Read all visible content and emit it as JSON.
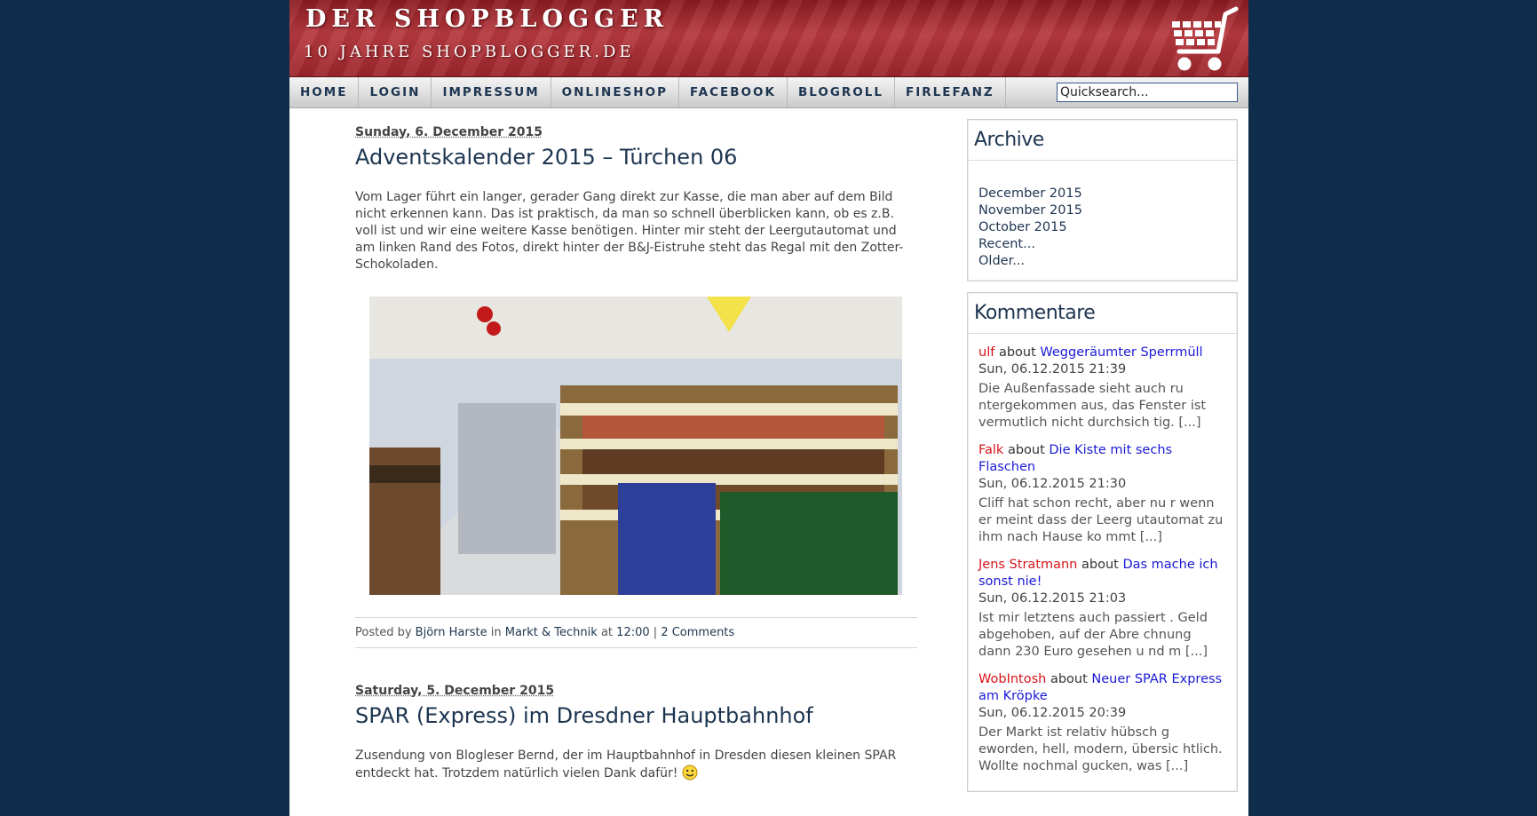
{
  "header": {
    "title": "DER SHOPBLOGGER",
    "subtitle": "10 JAHRE SHOPBLOGGER.DE"
  },
  "nav": {
    "items": [
      "HOME",
      "LOGIN",
      "IMPRESSUM",
      "ONLINESHOP",
      "FACEBOOK",
      "BLOGROLL",
      "FIRLEFANZ"
    ],
    "search_placeholder": "Quicksearch..."
  },
  "posts": [
    {
      "date": "Sunday, 6. December 2015",
      "title": "Adventskalender 2015 – Türchen 06",
      "body": "Vom Lager führt ein langer, gerader Gang direkt zur Kasse, die man aber auf dem Bild nicht erkennen kann. Das ist praktisch, da man so schnell überblicken kann, ob es z.B. voll ist und wir eine weitere Kasse benötigen. Hinter mir steht der Leergutautomat und am linken Rand des Fotos, direkt hinter der B&J-Eistruhe steht das Regal mit den Zotter-Schokoladen.",
      "footer": {
        "posted_by_label": "Posted by",
        "author": "Björn Harste",
        "in_label": "in",
        "category": "Markt & Technik",
        "at_label": "at",
        "time": "12:00",
        "separator": "|",
        "comments": "2 Comments"
      }
    },
    {
      "date": "Saturday, 5. December 2015",
      "title": "SPAR (Express) im Dresdner Hauptbahnhof",
      "body": "Zusendung von Blogleser Bernd, der im Hauptbahnhof in Dresden diesen kleinen SPAR entdeckt hat. Trotzdem natürlich vielen Dank dafür!"
    }
  ],
  "sidebar": {
    "archive": {
      "title": "Archive",
      "items": [
        "December 2015",
        "November 2015",
        "October 2015",
        "Recent...",
        "Older..."
      ]
    },
    "comments": {
      "title": "Kommentare",
      "about_label": "about",
      "items": [
        {
          "author": "ulf",
          "post": "Weggeräumter Sperrmüll",
          "time": "Sun, 06.12.2015 21:39",
          "text": "Die Außenfassade sieht auch ru ntergekommen aus, das Fenster ist vermutlich nicht durchsich tig. [...]"
        },
        {
          "author": "Falk",
          "post": "Die Kiste mit sechs Flaschen",
          "time": "Sun, 06.12.2015 21:30",
          "text": "Cliff hat schon recht, aber nu r wenn er meint dass der Leerg utautomat zu ihm nach Hause ko mmt [...]"
        },
        {
          "author": "Jens Stratmann",
          "post": "Das mache ich sonst nie!",
          "time": "Sun, 06.12.2015 21:03",
          "text": "Ist mir letztens auch passiert . Geld abgehoben, auf der Abre chnung dann 230 Euro gesehen u nd m [...]"
        },
        {
          "author": "WobIntosh",
          "post": "Neuer SPAR Express am Kröpke",
          "time": "Sun, 06.12.2015 20:39",
          "text": "Der Markt ist relativ hübsch g eworden, hell, modern, übersic htlich. Wollte nochmal gucken, was [...]"
        }
      ]
    }
  },
  "colors": {
    "background": "#0f2d4a",
    "header_red": "#a62a30",
    "link_blue": "#1d3550",
    "author_red": "#d7141a",
    "comment_link": "#1a1ad6"
  }
}
